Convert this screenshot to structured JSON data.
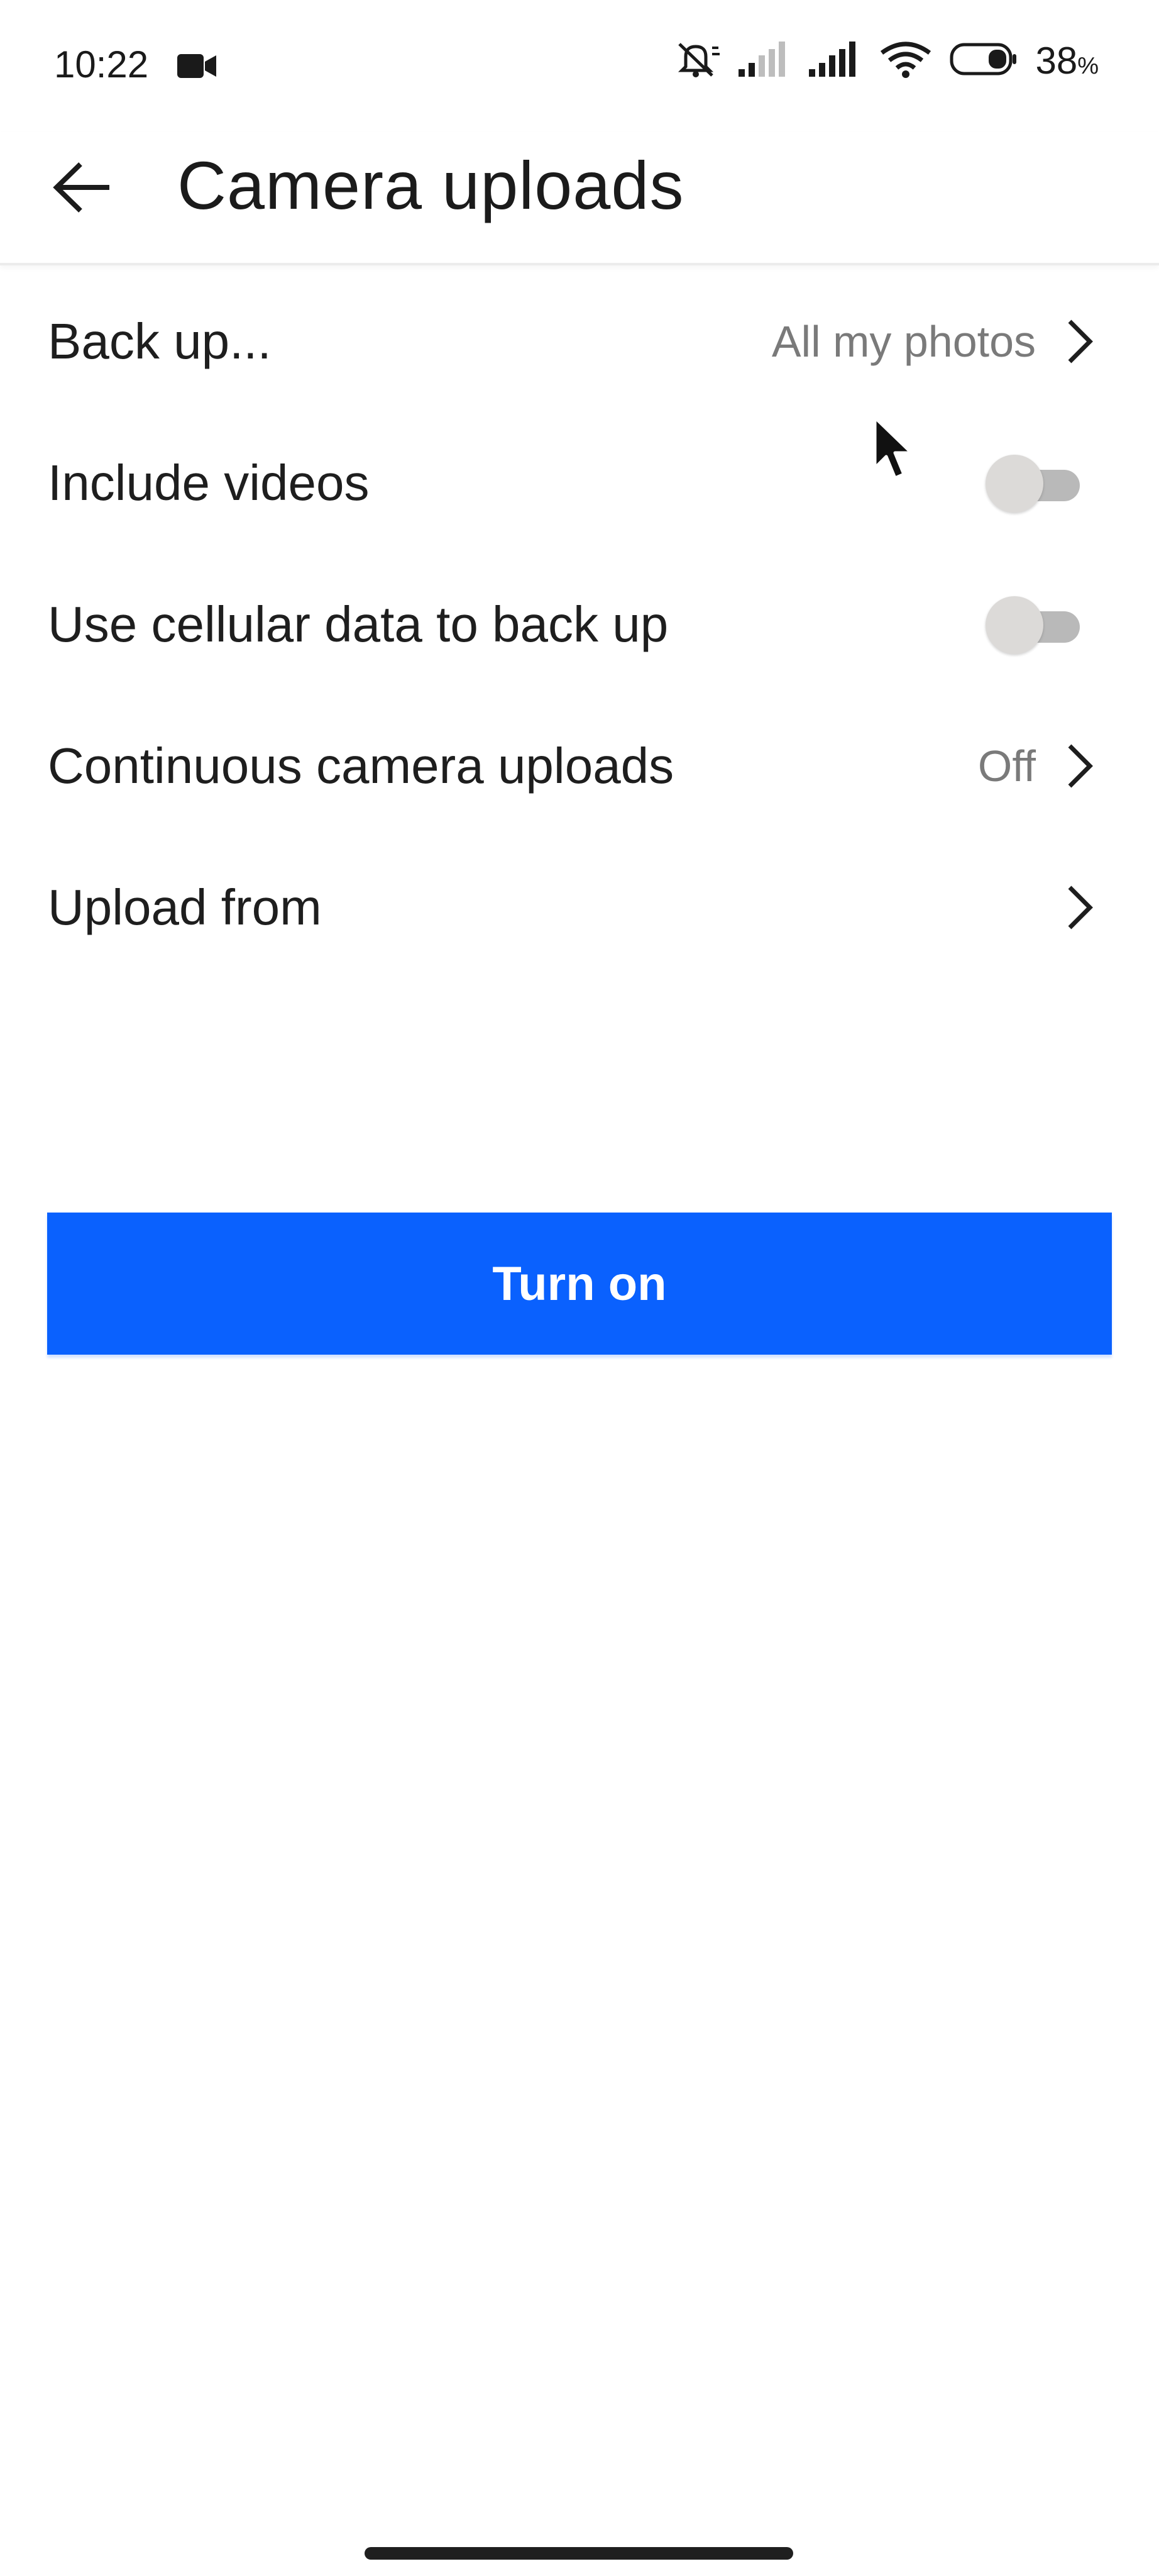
{
  "status_bar": {
    "time": "10:22",
    "battery_value": "38",
    "battery_unit": "%",
    "icons": [
      "video-camera-icon",
      "muted-bell-icon",
      "cell-signal-icon",
      "wifi-icon",
      "battery-icon"
    ]
  },
  "app_bar": {
    "title": "Camera uploads",
    "back_icon": "arrow-left-icon"
  },
  "settings": {
    "items": [
      {
        "label": "Back up...",
        "value": "All my photos",
        "control": "chevron"
      },
      {
        "label": "Include videos",
        "control": "toggle",
        "state": "off"
      },
      {
        "label": "Use cellular data to back up",
        "control": "toggle",
        "state": "off"
      },
      {
        "label": "Continuous camera uploads",
        "value": "Off",
        "control": "chevron"
      },
      {
        "label": "Upload from",
        "control": "chevron"
      }
    ]
  },
  "primary_button": {
    "label": "Turn on"
  },
  "colors": {
    "accent": "#0a61fe",
    "text": "#1e1e1e",
    "secondary_text": "#7a7a7a",
    "toggle_off_track": "#b9b9b9",
    "toggle_off_thumb": "#dcdad8"
  }
}
